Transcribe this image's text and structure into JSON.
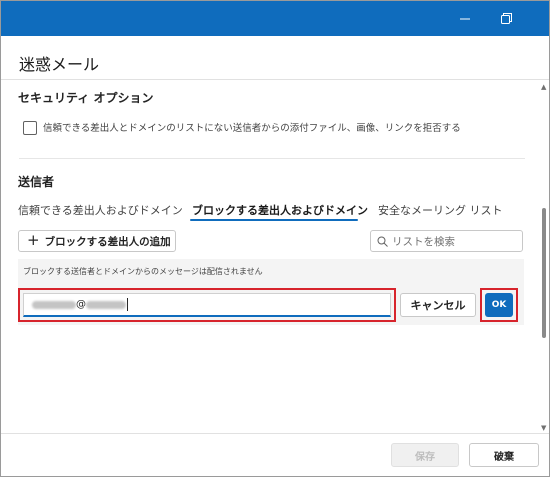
{
  "dialog": {
    "title": "迷惑メール",
    "accent_color": "#0f6cbd",
    "highlight_color": "#d7242c"
  },
  "titlebar": {
    "buttons": [
      "minimize-icon",
      "restore-icon"
    ]
  },
  "security": {
    "heading": "セキュリティ オプション",
    "checkbox_label": "信頼できる差出人とドメインのリストにない送信者からの添付ファイル、画像、リンクを拒否する",
    "checkbox_checked": false
  },
  "senders": {
    "heading": "送信者",
    "tabs": [
      {
        "label": "信頼できる差出人およびドメイン",
        "active": false
      },
      {
        "label": "ブロックする差出人およびドメイン",
        "active": true
      },
      {
        "label": "安全なメーリング リスト",
        "active": false
      }
    ],
    "add_button": "ブロックする差出人の追加",
    "search_placeholder": "リストを検索",
    "info_text": "ブロックする送信者とドメインからのメッセージは配信されません",
    "email_at": "@",
    "cancel_button": "キャンセル",
    "ok_button": "OK"
  },
  "footer": {
    "save_button": "保存",
    "discard_button": "破棄"
  }
}
